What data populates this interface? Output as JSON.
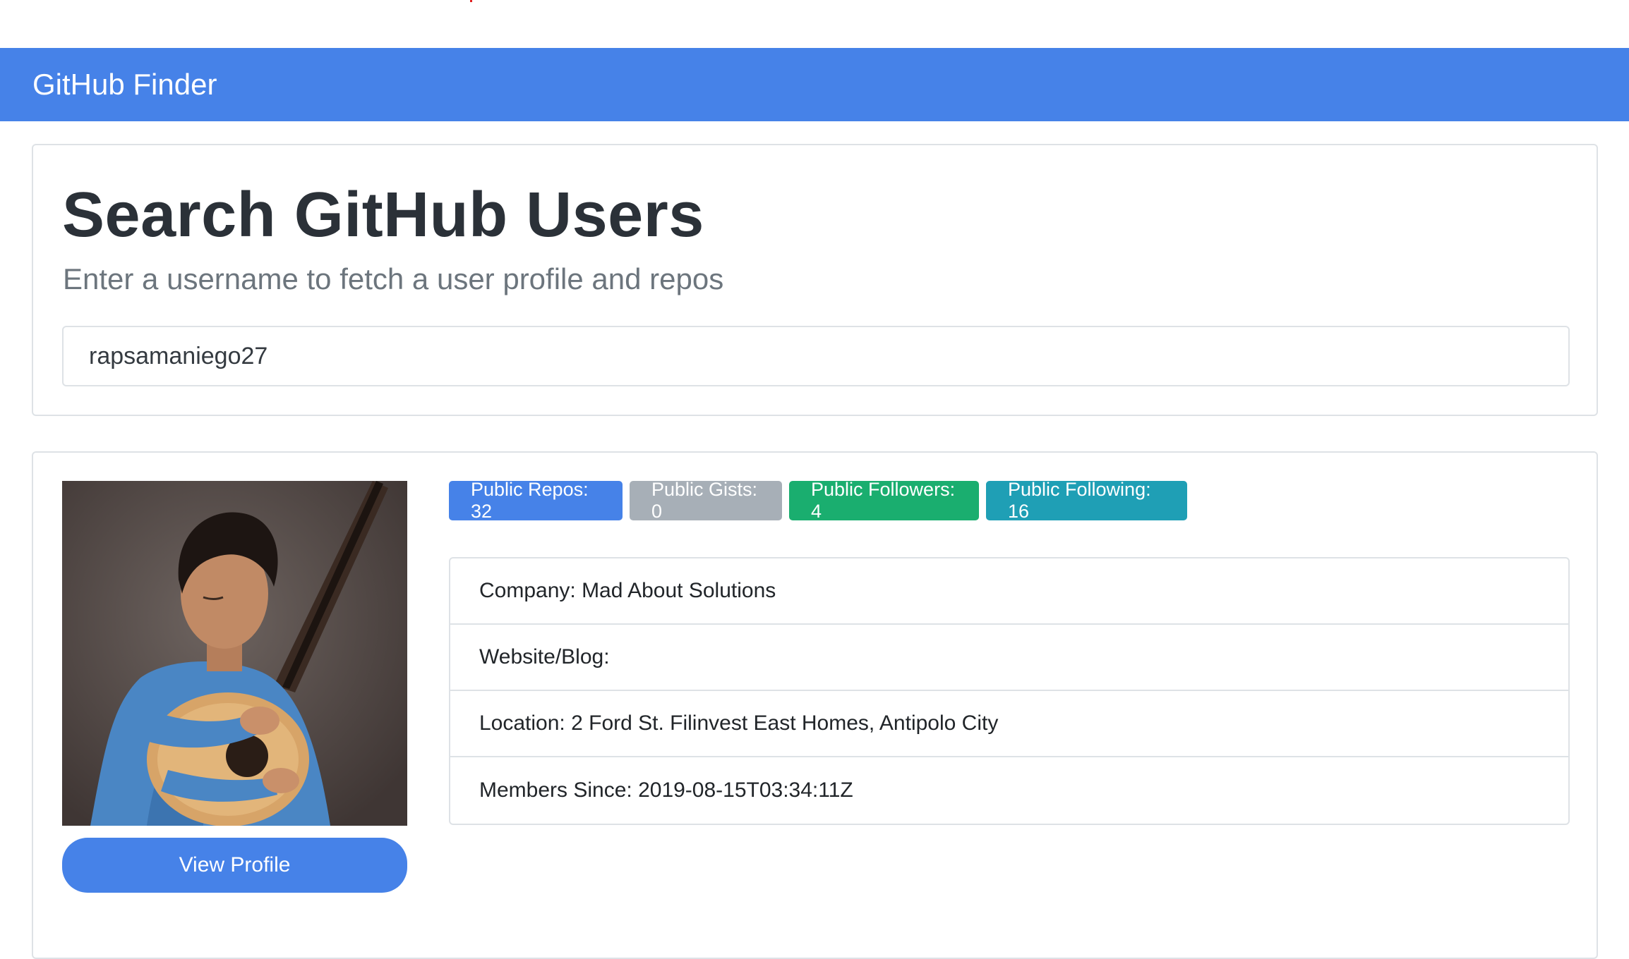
{
  "navbar": {
    "brand": "GitHub Finder"
  },
  "search": {
    "title": "Search GitHub Users",
    "lead": "Enter a username to fetch a user profile and repos",
    "value": "rapsamaniego27"
  },
  "profile": {
    "view_profile_label": "View Profile",
    "badges": {
      "repos": "Public Repos: 32",
      "gists": "Public Gists: 0",
      "followers": "Public Followers: 4",
      "following": "Public Following: 16"
    },
    "info": {
      "company": "Company: Mad About Solutions",
      "website": "Website/Blog:",
      "location": "Location: 2 Ford St. Filinvest East Homes, Antipolo City",
      "member_since": "Members Since: 2019-08-15T03:34:11Z"
    }
  },
  "colors": {
    "primary": "#4682e8",
    "secondary": "#a7afb7",
    "success": "#1aae6f",
    "info": "#1f9fb5"
  }
}
